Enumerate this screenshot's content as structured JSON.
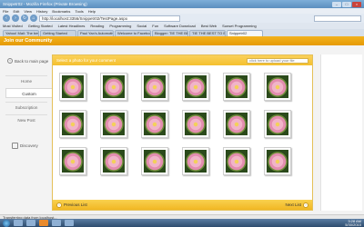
{
  "window": {
    "title": "Snippetr02 - Mozilla Firefox (Private Browsing)",
    "controls": [
      "–",
      "□",
      "×"
    ]
  },
  "menu": [
    "File",
    "Edit",
    "View",
    "History",
    "Bookmarks",
    "Tools",
    "Help"
  ],
  "navigation": {
    "url": "http://localhost:3356/Snippetr02/TestPage.aspx"
  },
  "bookmarks": [
    "Most Visited",
    "Getting Started",
    "Latest Headlines",
    "Reading",
    "Programming",
    "Social",
    "Fun",
    "Software Download",
    "Best Web",
    "Sunset Programming"
  ],
  "tabs": [
    {
      "label": "Yahoo! Mail: The best web..."
    },
    {
      "label": "Getting Started"
    },
    {
      "label": "Paul Yan's Automotive Mu..."
    },
    {
      "label": "Welcome to Facebook"
    },
    {
      "label": "Blogger: TIE THE BEST TO..."
    },
    {
      "label": "TIE THE BEST TO BEAT TH..."
    },
    {
      "label": "Snippetr02",
      "active": true
    }
  ],
  "app": {
    "header_title": "Join our Community"
  },
  "sidebar": {
    "back_label": "Back to main page",
    "items": [
      {
        "label": "Home"
      },
      {
        "label": "Custom",
        "active": true
      },
      {
        "label": "Subscription"
      },
      {
        "label": "New Post"
      }
    ],
    "discovery_label": "Discovery"
  },
  "panel": {
    "heading": "Select a photo for your comment",
    "upload_placeholder": "click here to upload your file",
    "previous_label": "Previous List",
    "next_label": "Next List",
    "thumbnail_count": 18
  },
  "status": {
    "text": "Transferring data from localhost..."
  },
  "tray": {
    "time": "3:28 AM",
    "date": "5/30/2010"
  }
}
